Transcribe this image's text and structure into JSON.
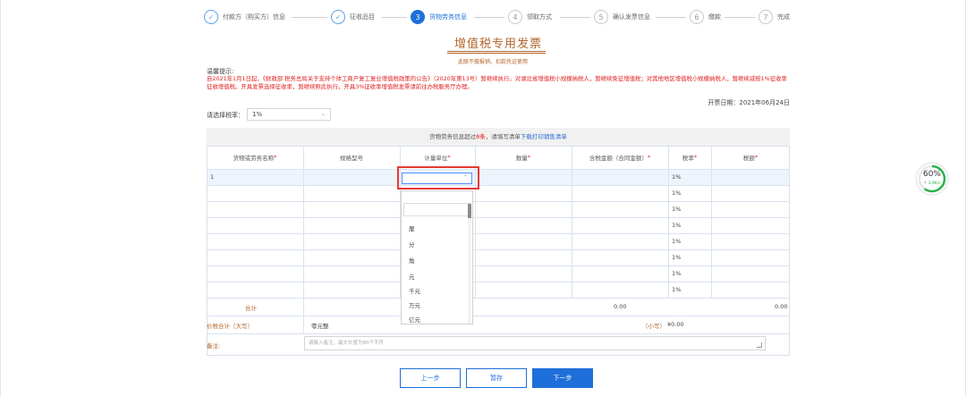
{
  "steps": [
    {
      "num": "✓",
      "label": "付款方（购买方）信息",
      "state": "done"
    },
    {
      "num": "✓",
      "label": "征收品目",
      "state": "done"
    },
    {
      "num": "3",
      "label": "货物劳务信息",
      "state": "active"
    },
    {
      "num": "4",
      "label": "领取方式",
      "state": "todo"
    },
    {
      "num": "5",
      "label": "确认发票信息",
      "state": "todo"
    },
    {
      "num": "6",
      "label": "缴款",
      "state": "todo"
    },
    {
      "num": "7",
      "label": "完成",
      "state": "todo"
    }
  ],
  "invoice": {
    "title": "增值税专用发票",
    "subtitle": "此联不做报销、扣款凭证使用"
  },
  "notice": {
    "heading": "温馨提示:",
    "text": "自2021年1月1日起，《财政部 税务总局关于支持个体工商户复工复业增值税政策的公告》（2020年第13号）暂继续执行。对湖北省增值税小规模纳税人，暂继续免征增值税；对其他地区增值税小规模纳税人，暂继续减按1%征收率征收增值税。开具发票选择征收率，暂继续照此执行。开具3%征收率增值税发票请前往办税服务厅办理。"
  },
  "issue_date": "开票日期：2021年06月24日",
  "rate": {
    "label": "请选择税率：",
    "value": "1%"
  },
  "info_bar": {
    "prefix": "货物劳务信息超过",
    "count": "8条",
    "middle": "，请填写清单",
    "link": "下载打印销售清单"
  },
  "table": {
    "headers": [
      {
        "label": "货物或劳务名称",
        "req": "*"
      },
      {
        "label": "规格型号",
        "req": ""
      },
      {
        "label": "计量单位",
        "req": "*"
      },
      {
        "label": "数量",
        "req": "*"
      },
      {
        "label": "含税金额（合同金额）",
        "req": " *"
      },
      {
        "label": "税率",
        "req": "*"
      },
      {
        "label": "税额",
        "req": "*"
      }
    ],
    "first_row_name": "1",
    "row_rates": [
      "1%",
      "1%",
      "1%",
      "1%",
      "1%",
      "1%",
      "1%",
      "1%"
    ],
    "total_label": "合计",
    "total_amount": "0.00",
    "total_tax": "0.00",
    "price_total_label": "价税合计（大写）",
    "price_total_upper": "零元整",
    "price_total_small_label": "（小写）",
    "price_total_small": "¥0.00",
    "remark_label": "备注:",
    "remark_placeholder": "请输入备注，最大长度为80个字符"
  },
  "unit_dropdown": {
    "options": [
      "",
      "厘",
      "分",
      "角",
      "元",
      "千元",
      "万元",
      "亿元"
    ]
  },
  "buttons": {
    "prev": "上一步",
    "save": "暂存",
    "next": "下一步"
  },
  "speed_widget": {
    "percent": "60%",
    "percent_value": 60,
    "rate": "↑ 3.9K/s"
  },
  "colors": {
    "accent": "#1e6fd9",
    "brown": "#b3642a",
    "warning": "#e02020",
    "highlight_box": "#e53935"
  }
}
